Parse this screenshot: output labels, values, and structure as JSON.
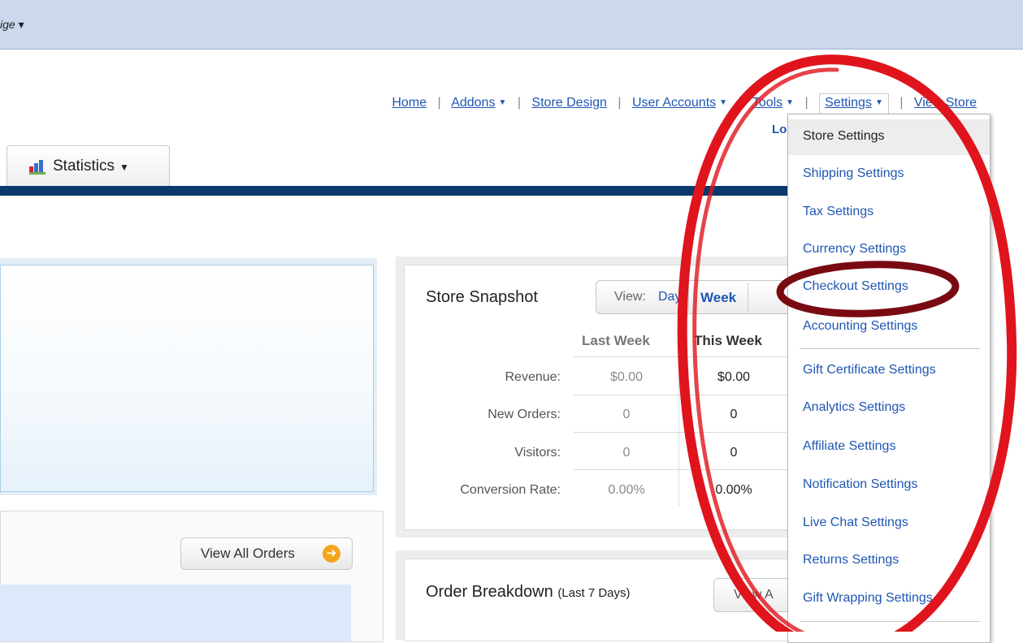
{
  "topbar": {
    "partial_label": "ige ▾"
  },
  "nav": {
    "home": "Home",
    "addons": "Addons",
    "store_design": "Store Design",
    "user_accounts": "User Accounts",
    "tools": "Tools",
    "settings": "Settings",
    "view_store": "View Store",
    "separator": "|",
    "login_partial": "Lo"
  },
  "tabs": {
    "statistics": "Statistics"
  },
  "orders": {
    "view_all": "View All Orders"
  },
  "snapshot": {
    "title": "Store Snapshot",
    "view_label": "View:",
    "view_day": "Day",
    "view_week": "Week",
    "col_last": "Last Week",
    "col_this": "This Week",
    "rows": [
      {
        "label": "Revenue:",
        "last": "$0.00",
        "this": "$0.00"
      },
      {
        "label": "New Orders:",
        "last": "0",
        "this": "0"
      },
      {
        "label": "Visitors:",
        "last": "0",
        "this": "0"
      },
      {
        "label": "Conversion Rate:",
        "last": "0.00%",
        "this": "0.00%"
      }
    ]
  },
  "breakdown": {
    "title": "Order Breakdown",
    "subtitle": "(Last 7 Days)",
    "view_button": "View A"
  },
  "settings_menu": [
    "Store Settings",
    "Shipping Settings",
    "Tax Settings",
    "Currency Settings",
    "Checkout Settings",
    "Accounting Settings",
    "Gift Certificate Settings",
    "Analytics Settings",
    "Affiliate Settings",
    "Notification Settings",
    "Live Chat Settings",
    "Returns Settings",
    "Gift Wrapping Settings"
  ],
  "colors": {
    "link": "#1f56b3",
    "nav_bar": "#0a3a6b",
    "annotation_red": "#e0141c",
    "annotation_dark_red": "#7a0a12",
    "arrow_orange": "#f4a51c"
  }
}
